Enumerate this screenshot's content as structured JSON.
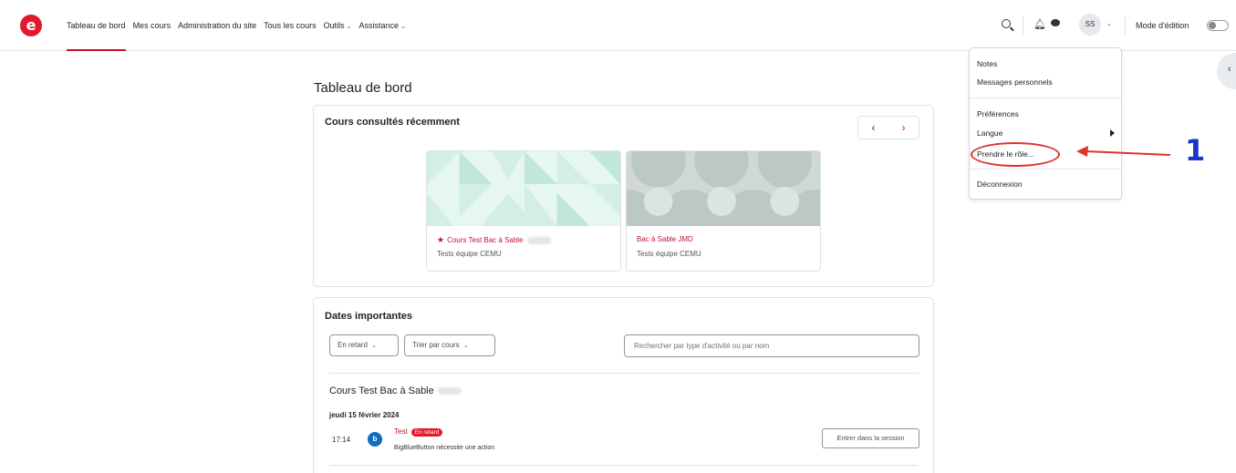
{
  "brand": {
    "logo_letter": "e",
    "accent": "#c8102e"
  },
  "nav": {
    "items": [
      {
        "label": "Tableau de bord",
        "active": true,
        "dropdown": false
      },
      {
        "label": "Mes cours",
        "active": false,
        "dropdown": false
      },
      {
        "label": "Administration du site",
        "active": false,
        "dropdown": false
      },
      {
        "label": "Tous les cours",
        "active": false,
        "dropdown": false
      },
      {
        "label": "Outils",
        "active": false,
        "dropdown": true
      },
      {
        "label": "Assistance",
        "active": false,
        "dropdown": true
      }
    ],
    "avatar_initials": "SS",
    "edit_mode_label": "Mode d'édition"
  },
  "main": {
    "page_title": "Tableau de bord",
    "recent": {
      "title": "Cours consultés récemment",
      "courses": [
        {
          "name": "Cours Test Bac à Sable",
          "category": "Tests équipe CEMU",
          "starred": true
        },
        {
          "name": "Bac à Sable JMD",
          "category": "Tests équipe CEMU",
          "starred": false
        }
      ]
    },
    "dates": {
      "title": "Dates importantes",
      "filter_label": "En retard",
      "sort_label": "Trier par cours",
      "search_placeholder": "Rechercher par type d'activité ou par nom",
      "group_title": "Cours Test Bac à Sable",
      "date": "jeudi 15 février 2024",
      "event": {
        "time": "17:14",
        "name": "Test",
        "badge": "En retard",
        "subtitle": "BigBlueButton nécessite une action",
        "action": "Entrer dans la session"
      }
    }
  },
  "user_menu": {
    "items_group1": [
      "Notes",
      "Messages personnels"
    ],
    "preferences": "Préférences",
    "language": "Langue",
    "switch_role": "Prendre le rôle...",
    "logout": "Déconnexion"
  },
  "annotation": {
    "number": "1",
    "arrow_color": "#d9372b",
    "number_color": "#1a35c9"
  }
}
